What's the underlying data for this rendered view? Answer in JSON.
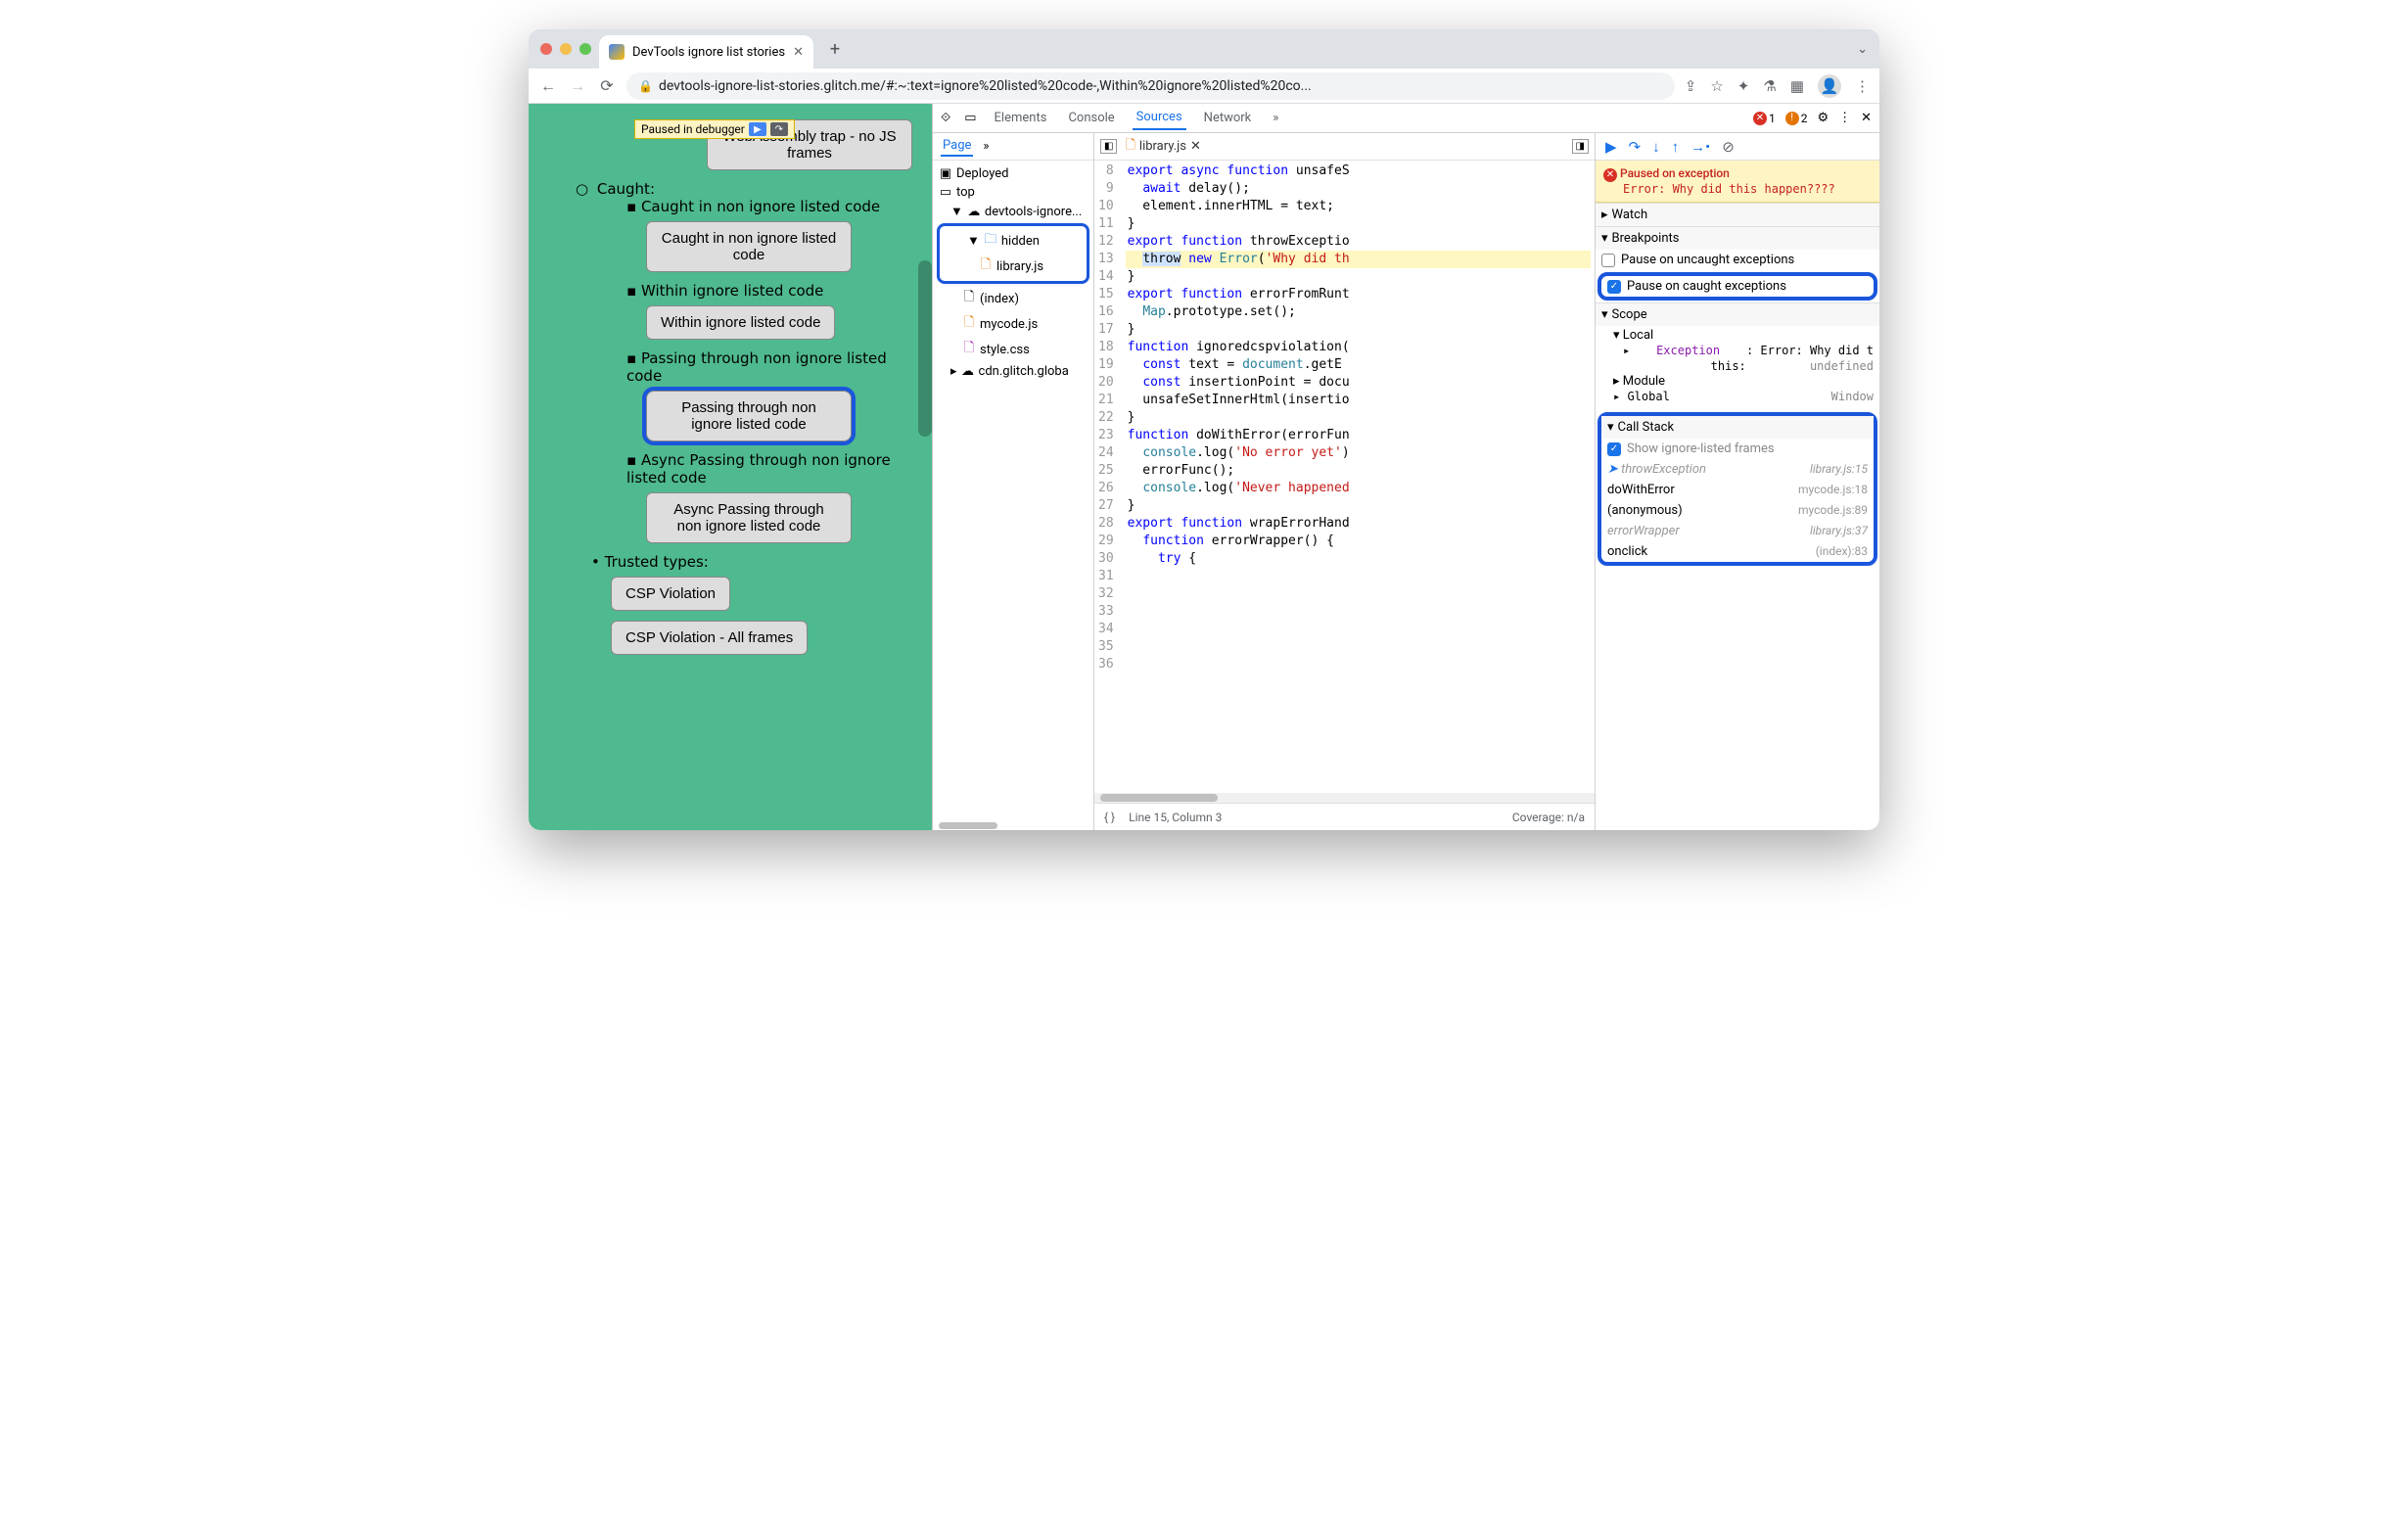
{
  "tab": {
    "title": "DevTools ignore list stories"
  },
  "address": "devtools-ignore-list-stories.glitch.me/#:~:text=ignore%20listed%20code-,Within%20ignore%20listed%20co...",
  "paused_label": "Paused in debugger",
  "page": {
    "item0": "WebAssembly trap - no JS frames",
    "caught": "Caught:",
    "c1": "Caught in non ignore listed code",
    "c1b": "Caught in non ignore listed code",
    "c2": "Within ignore listed code",
    "c2b": "Within ignore listed code",
    "c3": "Passing through non ignore listed code",
    "c3b": "Passing through non ignore listed code",
    "c4": "Async Passing through non ignore listed code",
    "c4b": "Async Passing through non ignore listed code",
    "tt": "Trusted types:",
    "tt1": "CSP Violation",
    "tt2": "CSP Violation - All frames"
  },
  "dtabs": {
    "elements": "Elements",
    "console": "Console",
    "sources": "Sources",
    "network": "Network",
    "more": "»"
  },
  "errors": {
    "err": "1",
    "warn": "2"
  },
  "nav": {
    "page": "Page",
    "more": "»",
    "deployed": "Deployed",
    "top": "top",
    "origin": "devtools-ignore...",
    "hidden": "hidden",
    "library": "library.js",
    "index": "(index)",
    "mycode": "mycode.js",
    "style": "style.css",
    "cdn": "cdn.glitch.globa"
  },
  "editor": {
    "file": "library.js"
  },
  "code": {
    "l8": "export async function unsafeS",
    "l9": "  await delay();",
    "l10": "  element.innerHTML = text;",
    "l11": "}",
    "l12": "",
    "l13": "",
    "l14": "export function throwExceptio",
    "l15": "  throw new Error('Why did th",
    "l16": "}",
    "l17": "",
    "l18": "export function errorFromRunt",
    "l19": "  Map.prototype.set();",
    "l20": "}",
    "l21": "",
    "l22": "function ignoredcspviolation(",
    "l23": "  const text = document.getE",
    "l24": "  const insertionPoint = docu",
    "l25": "  unsafeSetInnerHtml(insertio",
    "l26": "}",
    "l27": "",
    "l28": "function doWithError(errorFun",
    "l29": "  console.log('No error yet')",
    "l30": "  errorFunc();",
    "l31": "  console.log('Never happened",
    "l32": "}",
    "l33": "",
    "l34": "export function wrapErrorHand",
    "l35": "  function errorWrapper() {",
    "l36": "    try {"
  },
  "status": {
    "pos": "Line 15, Column 3",
    "coverage": "Coverage: n/a"
  },
  "pause": {
    "title": "Paused on exception",
    "msg": "Error: Why did this happen????"
  },
  "sects": {
    "watch": "Watch",
    "bp": "Breakpoints",
    "scope": "Scope",
    "cs": "Call Stack"
  },
  "bp": {
    "un": "Pause on uncaught exceptions",
    "ca": "Pause on caught exceptions"
  },
  "scope": {
    "local": "Local",
    "exc": "Exception",
    "excv": ": Error: Why did t",
    "this": "this: ",
    "thisv": "undefined",
    "module": "Module",
    "global": "Global",
    "window": "Window"
  },
  "cs": {
    "show": "Show ignore-listed frames",
    "r": [
      {
        "n": "throwException",
        "l": "library.js:15",
        "ig": true,
        "cur": true
      },
      {
        "n": "doWithError",
        "l": "mycode.js:18"
      },
      {
        "n": "(anonymous)",
        "l": "mycode.js:89"
      },
      {
        "n": "errorWrapper",
        "l": "library.js:37",
        "ig": true
      },
      {
        "n": "onclick",
        "l": "(index):83"
      }
    ]
  }
}
